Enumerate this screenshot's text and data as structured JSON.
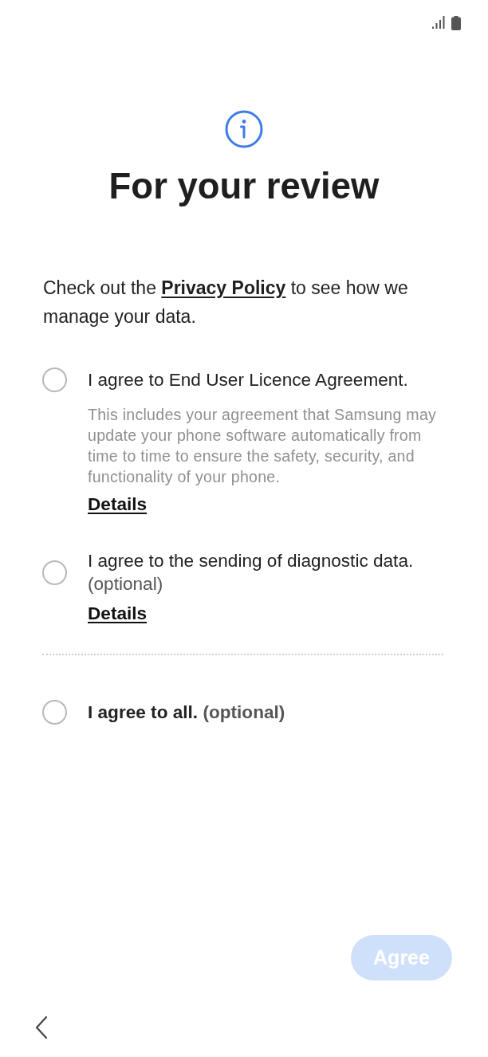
{
  "title": "For your review",
  "intro": {
    "before": "Check out the ",
    "link": "Privacy Policy",
    "after": " to see how we manage your data."
  },
  "agreements": [
    {
      "label": "I agree to End User Licence Agreement.",
      "note": "This includes your agreement that Samsung may update your phone software automatically from time to time to ensure the safety, security, and functionality of your phone.",
      "link": "Details",
      "checked": false
    },
    {
      "label": "I agree to the sending of diagnostic data.",
      "optional": "(optional)",
      "link": "Details",
      "checked": false
    }
  ],
  "agree_all": {
    "label": "I agree to all.",
    "optional": "(optional)",
    "checked": false
  },
  "agree_button": {
    "label": "Agree",
    "disabled": true
  }
}
